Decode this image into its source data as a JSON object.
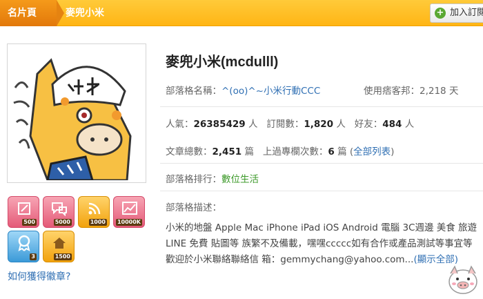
{
  "header": {
    "home_label": "名片頁",
    "current_label": "麥兜小米",
    "follow_button": "加入訂閱"
  },
  "profile": {
    "name": "麥兜小米(mcdulll)",
    "blog_name_label": "部落格名稱：",
    "blog_name": "^(oo)^~小米行動CCC",
    "days_label": "使用痞客邦：",
    "days_value": "2,218 天",
    "popularity_label": "人氣：",
    "popularity_value": "26385429",
    "popularity_unit": "人",
    "subs_label": "訂閱數：",
    "subs_value": "1,820",
    "subs_unit": "人",
    "friends_label": "好友：",
    "friends_value": "484",
    "friends_unit": "人",
    "articles_label": "文章總數：",
    "articles_value": "2,451",
    "articles_unit": "篇",
    "featured_label": "上過專欄次數：",
    "featured_value": "6",
    "featured_unit": "篇",
    "all_list_open": "(",
    "all_list_link": "全部列表",
    "all_list_close": ")",
    "rank_label": "部落格排行：",
    "rank_value": "數位生活",
    "desc_label": "部落格描述：",
    "description": "小米的地盤 Apple Mac iPhone iPad iOS Android 電腦 3C週邊 美食 旅遊 LINE 免費 貼圖等 族繁不及備載，嘿嘿ccccc如有合作或產品測試等事宜等歡迎於小米聯絡聯絡信 箱：gemmychang@yahoo.com...",
    "show_all_link": "(顯示全部)"
  },
  "badges": [
    {
      "icon": "pencil-icon",
      "count": "500",
      "color": "pink"
    },
    {
      "icon": "comment-icon",
      "count": "5000",
      "color": "pink"
    },
    {
      "icon": "rss-icon",
      "count": "1000",
      "color": "orange"
    },
    {
      "icon": "chart-icon",
      "count": "10000K",
      "color": "pink"
    },
    {
      "icon": "medal-icon",
      "count": "3",
      "color": "blue"
    },
    {
      "icon": "house-icon",
      "count": "1500",
      "color": "orange"
    }
  ],
  "badge_help_link": "如何獲得徽章?"
}
